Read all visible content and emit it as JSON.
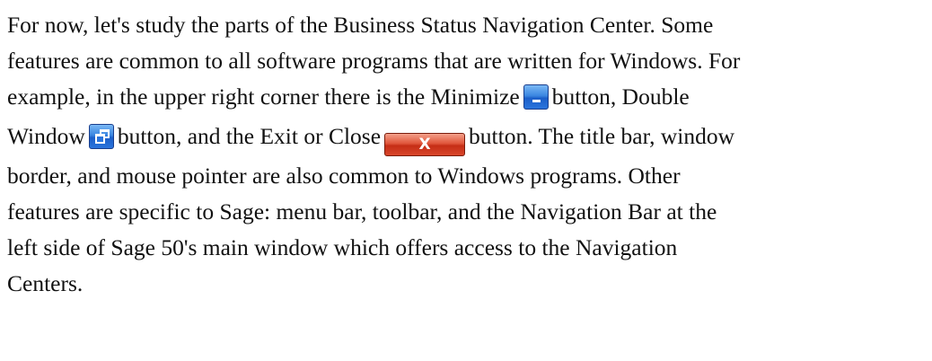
{
  "paragraph": {
    "l1": "For now, let's study the parts of the Business Status Navigation Center. Some",
    "l2": "features are common to all software programs that are written for Windows. For",
    "l3_a": "example, in the upper right corner there is the Minimize",
    "l3_b": "button, Double",
    "l4_a": "Window",
    "l4_b": "button, and the Exit or Close",
    "l4_c": "button. The title bar, window",
    "l5": "border, and mouse pointer are also common to Windows programs.  Other",
    "l6": "features are specific to Sage: menu bar, toolbar, and the Navigation Bar at the",
    "l7": "left side of Sage 50's main window which offers access to the Navigation",
    "l8": "Centers."
  },
  "icons": {
    "minimize": "minimize-button-icon",
    "restore": "restore-button-icon",
    "close": "close-button-icon",
    "close_glyph": "X"
  }
}
